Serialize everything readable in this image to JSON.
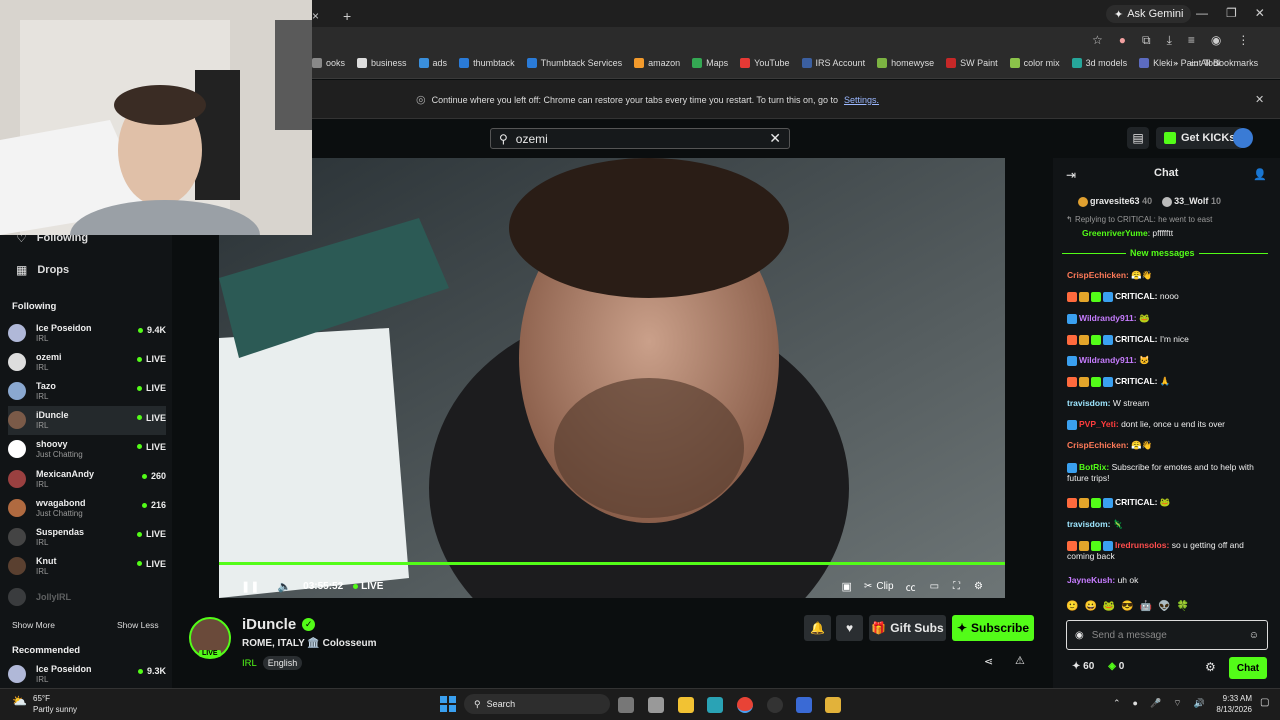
{
  "browser": {
    "tab_close": "×",
    "new_tab": "+",
    "ask_gemini": "Ask Gemini",
    "bookmarks": [
      {
        "label": "ooks",
        "color": "#888"
      },
      {
        "label": "business",
        "color": "#ddd"
      },
      {
        "label": "ads",
        "color": "#3a8fdc"
      },
      {
        "label": "thumbtack",
        "color": "#2a7bd8"
      },
      {
        "label": "Thumbtack Services",
        "color": "#2a7bd8"
      },
      {
        "label": "amazon",
        "color": "#f29a2c"
      },
      {
        "label": "Maps",
        "color": "#34a853"
      },
      {
        "label": "YouTube",
        "color": "#e53935"
      },
      {
        "label": "IRS Account",
        "color": "#3b5fa0"
      },
      {
        "label": "homewyse",
        "color": "#7cb342"
      },
      {
        "label": "SW Paint",
        "color": "#c62828"
      },
      {
        "label": "color mix",
        "color": "#8bc34a"
      },
      {
        "label": "3d models",
        "color": "#26a69a"
      },
      {
        "label": "Kleki - Paint Tool",
        "color": "#5c6bc0"
      }
    ],
    "bookmarks_more": "»",
    "all_bookmarks": "All Bookmarks",
    "infobar_text": "Continue where you left off: Chrome can restore your tabs every time you restart. To turn this on, go to",
    "infobar_link": "Settings."
  },
  "kick": {
    "search_value": "ozemi",
    "get_kicks": "Get KICKs"
  },
  "sidebar": {
    "nav_following": "Following",
    "nav_drops": "Drops",
    "following_header": "Following",
    "following": [
      {
        "name": "Ice Poseidon",
        "category": "IRL",
        "status": "9.4K",
        "live": false,
        "color": "#b0b8d8"
      },
      {
        "name": "ozemi",
        "category": "IRL",
        "status": "LIVE",
        "live": true,
        "color": "#dddddd"
      },
      {
        "name": "Tazo",
        "category": "IRL",
        "status": "LIVE",
        "live": true,
        "color": "#8aa8d0"
      },
      {
        "name": "iDuncle",
        "category": "IRL",
        "status": "LIVE",
        "live": true,
        "color": "#7a5a48"
      },
      {
        "name": "shoovy",
        "category": "Just Chatting",
        "status": "LIVE",
        "live": true,
        "color": "#ffffff"
      },
      {
        "name": "MexicanAndy",
        "category": "IRL",
        "status": "260",
        "live": false,
        "color": "#9a4040"
      },
      {
        "name": "wvagabond",
        "category": "Just Chatting",
        "status": "216",
        "live": false,
        "color": "#b06a40"
      },
      {
        "name": "Suspendas",
        "category": "IRL",
        "status": "LIVE",
        "live": true,
        "color": "#444444"
      },
      {
        "name": "Knut",
        "category": "IRL",
        "status": "LIVE",
        "live": true,
        "color": "#5a4030"
      }
    ],
    "faded_name": "JollyIRL",
    "show_more": "Show More",
    "show_less": "Show Less",
    "recommended_header": "Recommended",
    "recommended": [
      {
        "name": "Ice Poseidon",
        "category": "IRL",
        "status": "9.3K",
        "color": "#b0b8d8"
      }
    ]
  },
  "player": {
    "time": "03:55:52",
    "live_label": "LIVE",
    "clip_label": "Clip",
    "progress": 1.0
  },
  "stream": {
    "streamer": "iDuncle",
    "live_badge": "LIVE",
    "title": "ROME, ITALY 🏛️ Colosseum",
    "category": "IRL",
    "language": "English",
    "gift_subs": "Gift Subs",
    "subscribe": "Subscribe"
  },
  "chat": {
    "title": "Chat",
    "pinned": [
      {
        "name": "gravesite63",
        "count": "40"
      },
      {
        "name": "33_Wolf",
        "count": "10"
      }
    ],
    "reply_text": "Replying to CRITICAL: he went to east",
    "reply_line": {
      "user": "GreenriverYume",
      "text": "pffffftt"
    },
    "new_messages": "New messages",
    "messages": [
      {
        "user": "CrispEchicken:",
        "color": "#ff7a59",
        "text": "😤👋"
      },
      {
        "user": "CRITICAL:",
        "color": "#ffffff",
        "text": "nooo"
      },
      {
        "user": "Wildrandy911:",
        "color": "#c77dff",
        "text": "🐸"
      },
      {
        "user": "CRITICAL:",
        "color": "#ffffff",
        "text": "I'm nice"
      },
      {
        "user": "Wildrandy911:",
        "color": "#c77dff",
        "text": "🐱"
      },
      {
        "user": "CRITICAL:",
        "color": "#ffffff",
        "text": "🙏"
      },
      {
        "user": "travisdom:",
        "color": "#9ee6ff",
        "text": "W stream"
      },
      {
        "user": "PVP_Yeti:",
        "color": "#ff3d3d",
        "text": "dont lie, once u end its over"
      },
      {
        "user": "CrispEchicken:",
        "color": "#ff7a59",
        "text": "😤👋"
      },
      {
        "user": "BotRix:",
        "color": "#53fc18",
        "text": "Subscribe for emotes and to help with future trips!"
      },
      {
        "user": "CRITICAL:",
        "color": "#ffffff",
        "text": "🐸"
      },
      {
        "user": "travisdom:",
        "color": "#9ee6ff",
        "text": "🦎"
      },
      {
        "user": "Iredrunsolos:",
        "color": "#ff4d4d",
        "text": "so u getting off and coming back"
      },
      {
        "user": "JayneKush:",
        "color": "#c77dff",
        "text": "uh ok"
      }
    ],
    "input_placeholder": "Send a message",
    "points": "60",
    "kicks": "0",
    "send_label": "Chat"
  },
  "taskbar": {
    "weather_temp": "65°F",
    "weather_desc": "Partly sunny",
    "search": "Search",
    "time": "9:33 AM",
    "date": "8/13/2026"
  },
  "colors": {
    "accent": "#53fc18",
    "bg": "#0b0e0f",
    "panel": "#111416"
  }
}
